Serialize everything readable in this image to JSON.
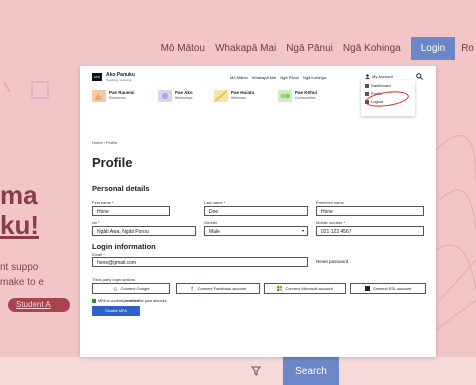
{
  "background": {
    "nav_links": [
      "Mō Mātou",
      "Whakapā Mai",
      "Ngā Pānui",
      "Ngā Kohinga"
    ],
    "login_label": "Login",
    "cut_label": "Ro",
    "heading_fragment_1": "ma",
    "heading_fragment_2": "ku!",
    "text_fragment_1": "nt suppo",
    "text_fragment_2": "make to e",
    "student_link": "Student A",
    "search_label": "Search"
  },
  "header": {
    "logo_mark": "AKO",
    "logo_title": "Ako Panuku",
    "logo_subtitle": "Teaching. Learning.",
    "links": [
      "Mō Mātou",
      "Whakapā Mai",
      "Ngā Pānui",
      "Ngā Kohinga"
    ],
    "account_label": "My Account"
  },
  "subnav": [
    {
      "title": "Pae Rauemi",
      "subtitle": "Resources"
    },
    {
      "title": "Pae Ako",
      "subtitle": "Workshops"
    },
    {
      "title": "Pae Huiata",
      "subtitle": "Webinars"
    },
    {
      "title": "Pae Kōhui",
      "subtitle": "Communities"
    }
  ],
  "account_menu": {
    "items": [
      "Dashboard",
      "Profile",
      "Logout"
    ]
  },
  "breadcrumb": "Home  /  Profile",
  "page_title": "Profile",
  "personal": {
    "heading": "Personal details",
    "first_name_label": "First name *",
    "first_name": "Hone",
    "last_name_label": "Last name *",
    "last_name": "Doe",
    "preferred_label": "Preferred name",
    "preferred": "Hone",
    "iwi_label": "Iwi *",
    "iwi": "Ngāti Awa, Ngāti Porou",
    "gender_label": "Gender",
    "gender": "Male",
    "mobile_label": "Mobile number *",
    "mobile": "021 123 4567"
  },
  "login": {
    "heading": "Login information",
    "email_label": "Email *",
    "email": "hone@gmail.com",
    "reset_label": "Reset password",
    "third_party_label": "Third-party login options",
    "connect": [
      "Connect Google",
      "Connect Facebook account",
      "Connect Microsoft account",
      "Connect ESL account"
    ],
    "mfa_prefix": "MFA is currently ",
    "mfa_status": "enabled",
    "mfa_suffix": " for your account",
    "disable_label": "Disable MFA"
  },
  "colors": {
    "background": "#f2c6c6",
    "primary": "#2f62c8",
    "login_button": "#6b87c8",
    "highlight_ring": "#d12a2a"
  }
}
